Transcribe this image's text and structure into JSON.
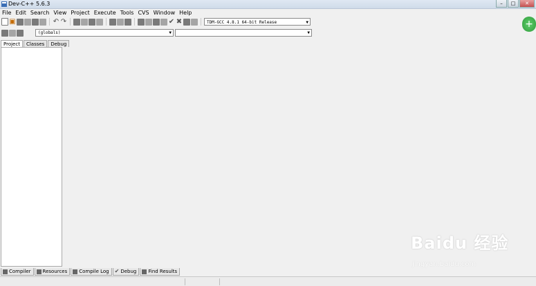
{
  "window": {
    "title": "Dev-C++ 5.6.3",
    "controls": [
      "minimize-icon",
      "maximize-icon",
      "close-icon"
    ]
  },
  "menu": [
    "File",
    "Edit",
    "Search",
    "View",
    "Project",
    "Execute",
    "Tools",
    "CVS",
    "Window",
    "Help"
  ],
  "toolbar": {
    "compiler": "TDM-GCC 4.8.1 64-bit Release",
    "scope_combo": "(globals)",
    "function_combo": ""
  },
  "left_tabs": [
    "Project",
    "Classes",
    "Debug"
  ],
  "bottom_tabs": [
    "Compiler",
    "Resources",
    "Compile Log",
    "Debug",
    "Find Results"
  ],
  "watermark": {
    "logo": "Baidu 经验",
    "url": "jingyan.baidu.com"
  },
  "colors": {
    "accent_green": "#3aa845",
    "panel_bg": "#f0f0f0"
  }
}
